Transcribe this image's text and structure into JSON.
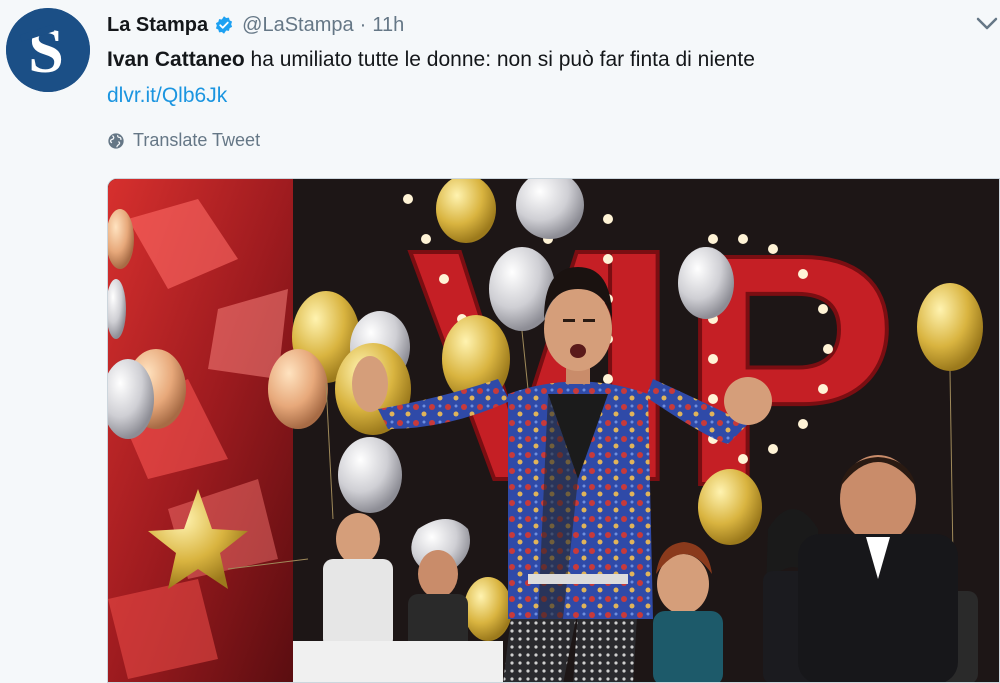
{
  "author": {
    "display_name": "La Stampa",
    "handle": "@LaStampa",
    "separator": "·",
    "time": "11h",
    "avatar_letter": "S"
  },
  "tweet": {
    "text_bold": "Ivan Cattaneo",
    "text_rest": " ha umiliato tutte le donne: non si può far finta di niente",
    "link": "dlvr.it/Qlb6Jk",
    "translate_label": "Translate Tweet"
  },
  "media": {
    "sign_letters": [
      "V",
      "I",
      "P"
    ]
  },
  "colors": {
    "link": "#1b95e0",
    "secondary_text": "#657786",
    "verified": "#1da1f2",
    "avatar_bg": "#1b4f86"
  },
  "icons": [
    "verified-badge-icon",
    "chevron-down-icon",
    "globe-icon"
  ]
}
